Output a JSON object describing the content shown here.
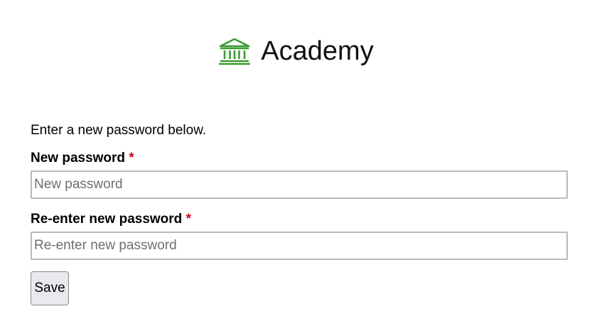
{
  "brand": {
    "name": "Academy",
    "icon": "bank-building-icon",
    "icon_color": "#3a9b2e"
  },
  "form": {
    "intro": "Enter a new password below.",
    "new_password": {
      "label": "New password",
      "required_marker": "*",
      "placeholder": "New password",
      "value": ""
    },
    "confirm_password": {
      "label": "Re-enter new password",
      "required_marker": "*",
      "placeholder": "Re-enter new password",
      "value": ""
    },
    "save_label": "Save"
  },
  "colors": {
    "required": "#d0021b",
    "button_bg": "#e9e9ed",
    "input_border": "#b9b9b9"
  }
}
